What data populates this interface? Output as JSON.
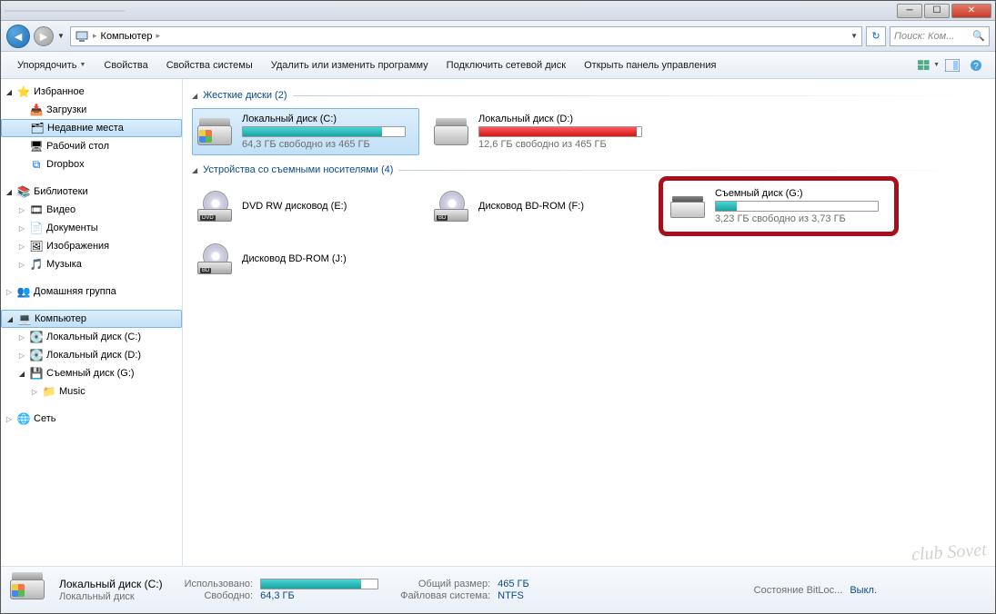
{
  "titlebar": {
    "blurred_text": "————————————"
  },
  "nav": {
    "breadcrumb_root_icon": "computer",
    "breadcrumb_item": "Компьютер",
    "search_placeholder": "Поиск: Ком..."
  },
  "toolbar": {
    "organize": "Упорядочить",
    "properties": "Свойства",
    "system_properties": "Свойства системы",
    "uninstall": "Удалить или изменить программу",
    "map_drive": "Подключить сетевой диск",
    "control_panel": "Открыть панель управления"
  },
  "sidebar": {
    "favorites": "Избранное",
    "downloads": "Загрузки",
    "recent": "Недавние места",
    "desktop": "Рабочий стол",
    "dropbox": "Dropbox",
    "libraries": "Библиотеки",
    "videos": "Видео",
    "documents": "Документы",
    "pictures": "Изображения",
    "music": "Музыка",
    "homegroup": "Домашняя группа",
    "computer": "Компьютер",
    "local_c": "Локальный диск (C:)",
    "local_d": "Локальный диск (D:)",
    "removable_g": "Съемный диск (G:)",
    "music_folder": "Music",
    "network": "Сеть"
  },
  "content": {
    "group_hdd": "Жесткие диски (2)",
    "group_removable": "Устройства со съемными носителями (4)",
    "drives": {
      "c": {
        "name": "Локальный диск (C:)",
        "free": "64,3 ГБ свободно из 465 ГБ",
        "fill_pct": 86
      },
      "d": {
        "name": "Локальный диск (D:)",
        "free": "12,6 ГБ свободно из 465 ГБ",
        "fill_pct": 97
      },
      "dvd_e": {
        "name": "DVD RW дисковод (E:)"
      },
      "bd_f": {
        "name": "Дисковод BD-ROM (F:)"
      },
      "g": {
        "name": "Съемный диск (G:)",
        "free": "3,23 ГБ свободно из 3,73 ГБ",
        "fill_pct": 13
      },
      "bd_j": {
        "name": "Дисковод BD-ROM (J:)"
      }
    }
  },
  "details": {
    "title": "Локальный диск (C:)",
    "subtitle": "Локальный диск",
    "used_label": "Использовано:",
    "free_label": "Свободно:",
    "free_value": "64,3 ГБ",
    "total_label": "Общий размер:",
    "total_value": "465 ГБ",
    "fs_label": "Файловая система:",
    "fs_value": "NTFS",
    "bitlocker_label": "Состояние BitLoc...",
    "bitlocker_value": "Выкл.",
    "bar_pct": 86
  },
  "watermark": "club Sovet"
}
